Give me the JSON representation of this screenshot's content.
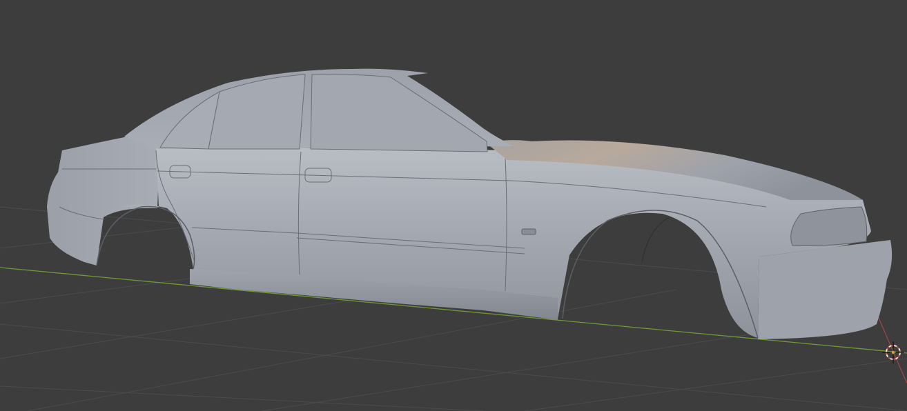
{
  "app": {
    "view": "3d-viewport",
    "shading": "solid"
  },
  "colors": {
    "background": "#3d3d3d",
    "grid": "#4b4b4b",
    "x_axis": "#6f9a38",
    "y_axis": "#9a4646",
    "body_light": "#b8bcc3",
    "body_mid": "#979ba4",
    "body_dark": "#6f737c",
    "window": "#a3a7b0",
    "cursor_outer": "#e8e8e8",
    "cursor_ring": "#d84b3a"
  },
  "scene": {
    "object": "car-body-shell",
    "cursor": "3d-cursor"
  }
}
